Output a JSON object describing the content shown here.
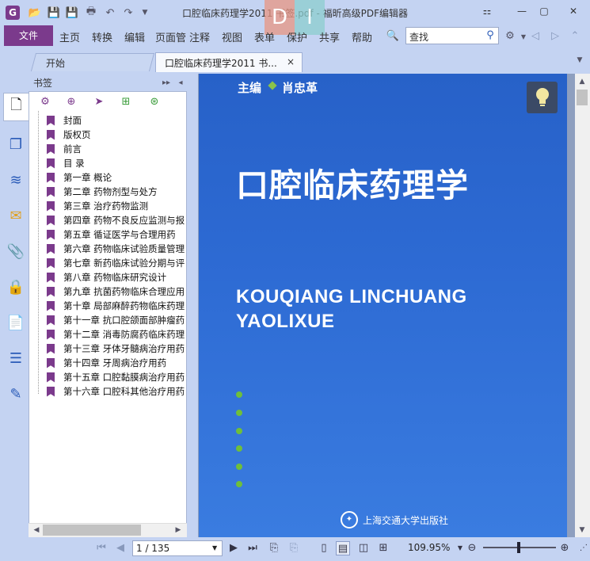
{
  "window": {
    "title": "口腔临床药理学2011 书签.pdf - 福昕高级PDF编辑器",
    "min_icon": "minimize-icon",
    "max_icon": "maximize-icon",
    "close_icon": "close-icon"
  },
  "ribbon": {
    "file_label": "文件",
    "menus": [
      "主页",
      "转换",
      "编辑",
      "页面管",
      "注释",
      "视图",
      "表单",
      "保护",
      "共享",
      "帮助"
    ],
    "search_placeholder": "查找"
  },
  "tabs": {
    "start": "开始",
    "doc": "口腔临床药理学2011 书...",
    "close": "×"
  },
  "bookmarks": {
    "title": "书签",
    "items": [
      "封面",
      "版权页",
      "前言",
      "目 录",
      "第一章 概论",
      "第二章 药物剂型与处方",
      "第三章 治疗药物监测",
      "第四章 药物不良反应监测与报",
      "第五章 循证医学与合理用药",
      "第六章 药物临床试验质量管理",
      "第七章 新药临床试验分期与评",
      "第八章 药物临床研究设计",
      "第九章 抗菌药物临床合理应用",
      "第十章 局部麻醉药物临床药理",
      "第十一章 抗口腔颌面部肿瘤药",
      "第十二章 消毒防腐药临床药理",
      "第十三章 牙体牙髓病治疗用药",
      "第十四章 牙周病治疗用药",
      "第十五章 口腔黏膜病治疗用药",
      "第十六章 口腔科其他治疗用药"
    ]
  },
  "page": {
    "editor_label": "主编",
    "editor_name": "肖忠革",
    "book_title": "口腔临床药理学",
    "pinyin_line1": "KOUQIANG LINCHUANG",
    "pinyin_line2": "YAOLIXUE",
    "publisher": "上海交通大学出版社"
  },
  "status": {
    "page_display": "1 / 135",
    "zoom": "109.95%",
    "zoom_level_fraction": 0.5
  },
  "colors": {
    "accent": "#7b3a8c",
    "chrome": "#c4d3f2",
    "cover_blue": "#2d6ad3"
  }
}
